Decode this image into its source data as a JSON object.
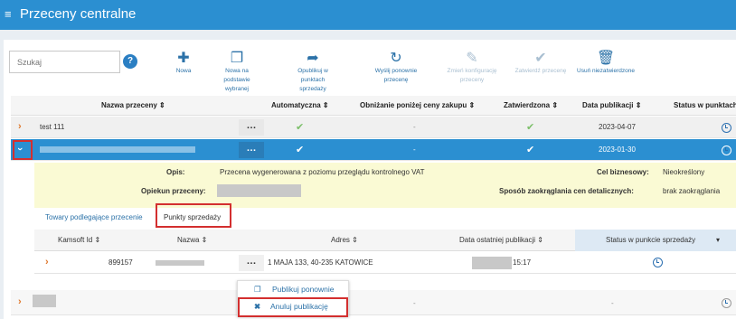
{
  "app": {
    "title": "Przeceny centralne"
  },
  "search": {
    "placeholder": "Szukaj"
  },
  "toolbar": [
    {
      "label": "Nowa",
      "icon": "plus-icon",
      "enabled": true
    },
    {
      "label": "Nowa na podstawie wybranej",
      "icon": "copy-icon",
      "enabled": true
    },
    {
      "label": "Opublikuj w punktach sprzedaży",
      "icon": "share-icon",
      "enabled": true
    },
    {
      "label": "Wyślij ponownie przecenę",
      "icon": "refresh-icon",
      "enabled": true
    },
    {
      "label": "Zmień konfigurację przeceny",
      "icon": "edit-icon",
      "enabled": false
    },
    {
      "label": "Zatwierdź przecenę",
      "icon": "check-icon",
      "enabled": false
    },
    {
      "label": "Usuń niezatwierdzone",
      "icon": "trash-icon",
      "enabled": true
    }
  ],
  "table": {
    "columns": [
      "Nazwa przeceny",
      "Automatyczna",
      "Obniżanie poniżej ceny zakupu",
      "Zatwierdzona",
      "Data publikacji",
      "Status w punktach s"
    ],
    "rows": [
      {
        "name": "test 111",
        "auto": true,
        "below": "-",
        "approved": true,
        "date": "2023-04-07"
      },
      {
        "name": "",
        "auto": true,
        "below": "-",
        "approved": true,
        "date": "2023-01-30"
      },
      {
        "name": "",
        "auto": false,
        "below": "-",
        "approved": false,
        "date": "-"
      }
    ]
  },
  "details": {
    "opis_label": "Opis:",
    "opis_value": "Przecena wygenerowana z poziomu przeglądu kontrolnego VAT",
    "opiekun_label": "Opiekun przeceny:",
    "cel_label": "Cel biznesowy:",
    "cel_value": "Nieokreślony",
    "sposob_label": "Sposób zaokrąglania cen detalicznych:",
    "sposob_value": "brak zaokrąglania"
  },
  "subtabs": [
    "Towary podlegające przecenie",
    "Punkty sprzedaży"
  ],
  "subtable": {
    "columns": [
      "Kamsoft Id",
      "Nazwa",
      "Adres",
      "Data ostatniej publikacji",
      "Status w punkcie sprzedaży"
    ],
    "row": {
      "id": "899157",
      "address": "1 MAJA 133, 40-235 KATOWICE",
      "time": "15:17"
    }
  },
  "context_menu": [
    {
      "label": "Publikuj ponownie",
      "icon": "copy-icon"
    },
    {
      "label": "Anuluj publikację",
      "icon": "close-icon"
    }
  ],
  "colors": {
    "header": "#2b8fd1",
    "selected_row": "#2b8fd1",
    "highlight": "#d32f2f",
    "details_bg": "#fafad4"
  }
}
